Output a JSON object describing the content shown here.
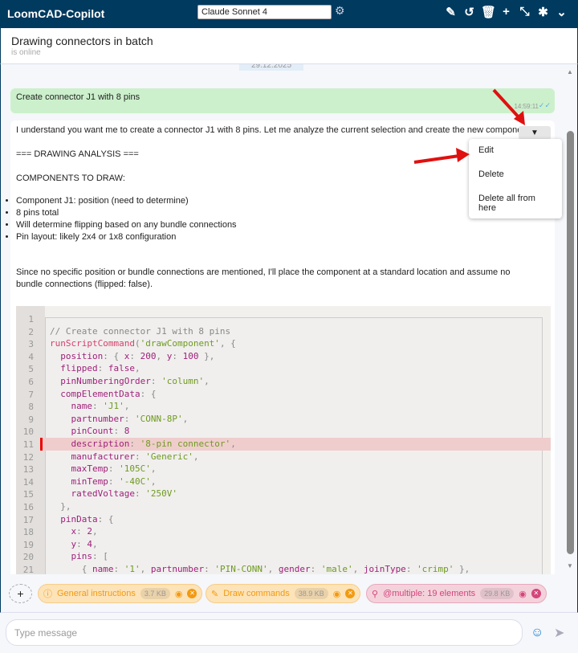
{
  "header": {
    "app_title": "LoomCAD-Copilot",
    "model": "Claude Sonnet 4",
    "icons": [
      "settings-icon",
      "pencil-icon",
      "history-icon",
      "trash-icon",
      "plus-icon",
      "compress-icon",
      "bug-icon",
      "chevron-down-icon"
    ]
  },
  "chat": {
    "title": "Drawing connectors in batch",
    "status": "is online",
    "date": "29.12.2025"
  },
  "user_message": {
    "text": "Create connector J1 with 8 pins",
    "time": "14:59:11"
  },
  "assistant_message": {
    "intro": "I understand you want me to create a connector J1 with 8 pins. Let me analyze the current selection and create the new component.",
    "analysis": "=== DRAWING ANALYSIS ===",
    "components": "COMPONENTS TO DRAW:",
    "bullets": [
      "Component J1: position (need to determine)",
      "8 pins total",
      "Will determine flipping based on any bundle connections",
      "Pin layout: likely 2x4 or 1x8 configuration"
    ],
    "conclusion": "Since no specific position or bundle connections are mentioned, I'll place the component at a standard location and assume no bundle connections (flipped: false).",
    "dropdown": "▼"
  },
  "menu": {
    "items": [
      "Edit",
      "Delete",
      "Delete all from here"
    ]
  },
  "code": {
    "highlight_line": 11,
    "lines": [
      [],
      [
        [
          "c",
          "// Create connector J1 with 8 pins"
        ]
      ],
      [
        [
          "f",
          "runScriptCommand"
        ],
        [
          "p0",
          "("
        ],
        [
          "s",
          "'drawComponent'"
        ],
        [
          "p0",
          ", {"
        ]
      ],
      [
        [
          "k",
          "  position"
        ],
        [
          "p0",
          ": { "
        ],
        [
          "k",
          "x"
        ],
        [
          "p0",
          ": "
        ],
        [
          "n",
          "200"
        ],
        [
          "p0",
          ", "
        ],
        [
          "k",
          "y"
        ],
        [
          "p0",
          ": "
        ],
        [
          "n",
          "100"
        ],
        [
          "p0",
          " },"
        ]
      ],
      [
        [
          "k",
          "  flipped"
        ],
        [
          "p0",
          ": "
        ],
        [
          "kw",
          "false"
        ],
        [
          "p0",
          ","
        ]
      ],
      [
        [
          "k",
          "  pinNumberingOrder"
        ],
        [
          "p0",
          ": "
        ],
        [
          "s",
          "'column'"
        ],
        [
          "p0",
          ","
        ]
      ],
      [
        [
          "k",
          "  compElementData"
        ],
        [
          "p0",
          ": {"
        ]
      ],
      [
        [
          "k",
          "    name"
        ],
        [
          "p0",
          ": "
        ],
        [
          "s",
          "'J1'"
        ],
        [
          "p0",
          ","
        ]
      ],
      [
        [
          "k",
          "    partnumber"
        ],
        [
          "p0",
          ": "
        ],
        [
          "s",
          "'CONN-8P'"
        ],
        [
          "p0",
          ","
        ]
      ],
      [
        [
          "k",
          "    pinCount"
        ],
        [
          "p0",
          ": "
        ],
        [
          "n",
          "8"
        ]
      ],
      [
        [
          "k",
          "    description"
        ],
        [
          "p0",
          ": "
        ],
        [
          "s",
          "'8-pin connector'"
        ],
        [
          "p0",
          ","
        ]
      ],
      [
        [
          "k",
          "    manufacturer"
        ],
        [
          "p0",
          ": "
        ],
        [
          "s",
          "'Generic'"
        ],
        [
          "p0",
          ","
        ]
      ],
      [
        [
          "k",
          "    maxTemp"
        ],
        [
          "p0",
          ": "
        ],
        [
          "s",
          "'105C'"
        ],
        [
          "p0",
          ","
        ]
      ],
      [
        [
          "k",
          "    minTemp"
        ],
        [
          "p0",
          ": "
        ],
        [
          "s",
          "'-40C'"
        ],
        [
          "p0",
          ","
        ]
      ],
      [
        [
          "k",
          "    ratedVoltage"
        ],
        [
          "p0",
          ": "
        ],
        [
          "s",
          "'250V'"
        ]
      ],
      [
        [
          "p0",
          "  },"
        ]
      ],
      [
        [
          "k",
          "  pinData"
        ],
        [
          "p0",
          ": {"
        ]
      ],
      [
        [
          "k",
          "    x"
        ],
        [
          "p0",
          ": "
        ],
        [
          "n",
          "2"
        ],
        [
          "p0",
          ","
        ]
      ],
      [
        [
          "k",
          "    y"
        ],
        [
          "p0",
          ": "
        ],
        [
          "n",
          "4"
        ],
        [
          "p0",
          ","
        ]
      ],
      [
        [
          "k",
          "    pins"
        ],
        [
          "p0",
          ": ["
        ]
      ],
      [
        [
          "p0",
          "      { "
        ],
        [
          "k",
          "name"
        ],
        [
          "p0",
          ": "
        ],
        [
          "s",
          "'1'"
        ],
        [
          "p0",
          ", "
        ],
        [
          "k",
          "partnumber"
        ],
        [
          "p0",
          ": "
        ],
        [
          "s",
          "'PIN-CONN'"
        ],
        [
          "p0",
          ", "
        ],
        [
          "k",
          "gender"
        ],
        [
          "p0",
          ": "
        ],
        [
          "s",
          "'male'"
        ],
        [
          "p0",
          ", "
        ],
        [
          "k",
          "joinType"
        ],
        [
          "p0",
          ": "
        ],
        [
          "s",
          "'crimp'"
        ],
        [
          "p0",
          " },"
        ]
      ]
    ]
  },
  "chips": [
    {
      "label": "General instructions",
      "size": "3.7 KB",
      "icon": "info-icon"
    },
    {
      "label": "Draw commands",
      "size": "38.9 KB",
      "icon": "pencil-icon"
    },
    {
      "label": "@multiple: 19 elements",
      "size": "29.8 KB",
      "icon": "search-icon"
    }
  ],
  "input": {
    "placeholder": "Type message"
  }
}
